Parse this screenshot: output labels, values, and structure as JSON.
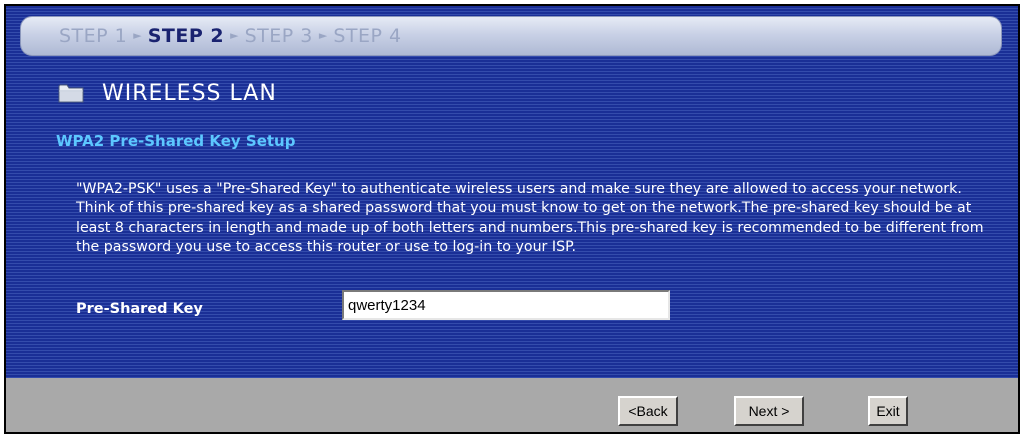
{
  "steps": {
    "step1": "STEP 1",
    "step2": "STEP 2",
    "step3": "STEP 3",
    "step4": "STEP 4"
  },
  "header": {
    "title": "WIRELESS LAN",
    "icon": "folder-icon"
  },
  "section": {
    "title": "WPA2 Pre-Shared Key Setup",
    "description": "\"WPA2-PSK\" uses a \"Pre-Shared Key\" to authenticate wireless users and make sure they are allowed to access your network. Think of this pre-shared key as a shared password that you must know to get on the network.The pre-shared key should be at least 8 characters in length and made up of both letters and numbers.This pre-shared key is recommended to be different from the password you use to access this router or use to log-in to your ISP."
  },
  "form": {
    "psk_label": "Pre-Shared Key",
    "psk_value": "qwerty1234"
  },
  "buttons": {
    "back": "<Back",
    "next": "Next >",
    "exit": "Exit"
  },
  "colors": {
    "panel_bg": "#1a2f96",
    "section_title": "#5cc8ff",
    "active_step": "#1a2370",
    "inactive_step": "#9aa6c4",
    "footer_bg": "#a9a9a9"
  }
}
